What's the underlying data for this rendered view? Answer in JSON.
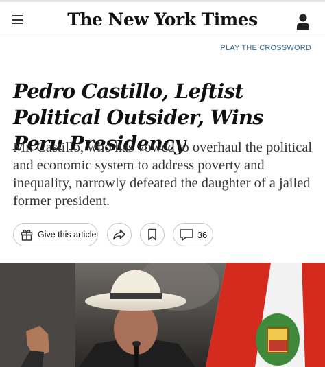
{
  "header": {
    "masthead": "The New York Times",
    "icons": {
      "menu": "hamburger-menu-icon",
      "account": "account-icon"
    }
  },
  "promo": {
    "crossword_link": "PLAY THE CROSSWORD"
  },
  "article": {
    "headline": "Pedro Castillo, Leftist Political Outsider, Wins Peru Presidency",
    "summary": "Mr. Castillo, who has vowed to overhaul the political and economic system to address poverty and inequality, narrowly defeated the daughter of a jailed former president."
  },
  "actions": {
    "gift_label": "Give this article",
    "gift_icon": "gift-icon",
    "share_icon": "share-arrow-icon",
    "save_icon": "bookmark-icon",
    "comments_icon": "comment-bubble-icon",
    "comment_count": "36"
  },
  "colors": {
    "link": "#326891",
    "text": "#121212",
    "border": "#c7c7c7",
    "flag_red": "#d52b1e"
  }
}
